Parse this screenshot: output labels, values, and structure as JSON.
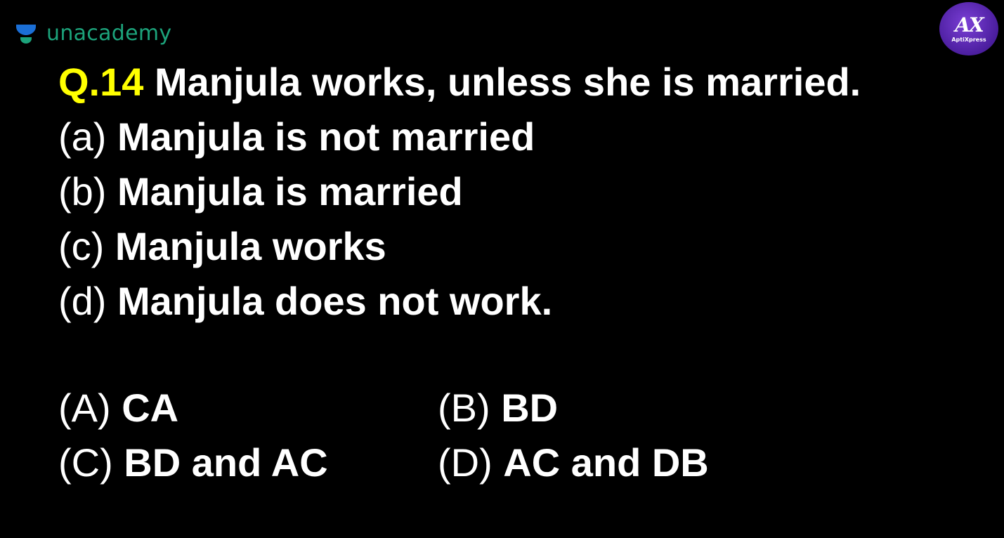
{
  "brand": {
    "name": "unacademy",
    "color": "#1ca37b"
  },
  "badge": {
    "mark": "AX",
    "name": "AptiXpress",
    "color": "#5a24b8"
  },
  "question": {
    "number": "Q.14",
    "text": " Manjula works, unless she is married.",
    "number_color": "#ffff00"
  },
  "statements": [
    {
      "label": "(a) ",
      "text": "Manjula is not married"
    },
    {
      "label": "(b) ",
      "text": "Manjula is married"
    },
    {
      "label": "(c) ",
      "text": "Manjula works"
    },
    {
      "label": "(d) ",
      "text": "Manjula does not work."
    }
  ],
  "options": [
    {
      "label": "(A) ",
      "text": "CA"
    },
    {
      "label": "(B) ",
      "text": "BD"
    },
    {
      "label": "(C) ",
      "text": "BD and AC"
    },
    {
      "label": "(D) ",
      "text": "AC and DB"
    }
  ]
}
